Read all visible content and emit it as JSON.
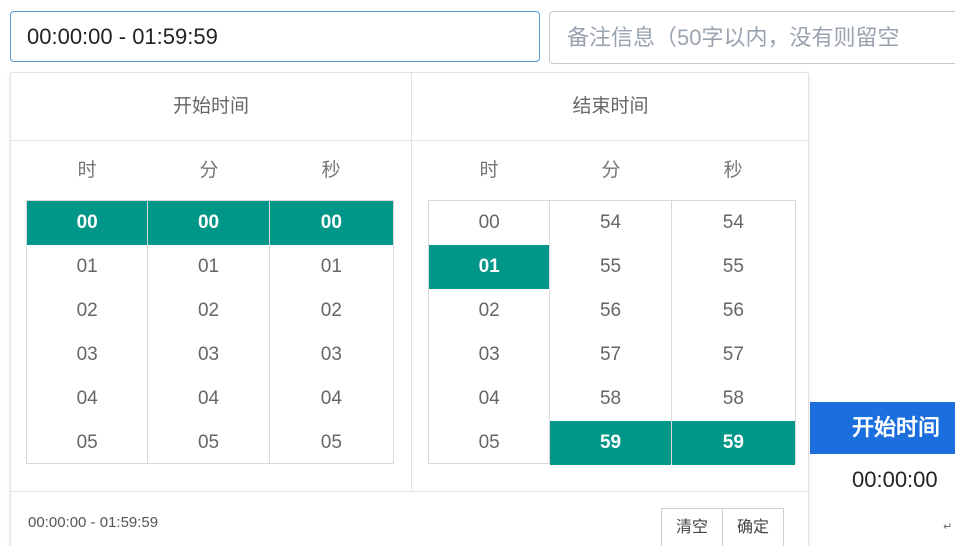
{
  "time_range_input": {
    "value": "00:00:00 - 01:59:59"
  },
  "remark_input": {
    "placeholder": "备注信息（50字以内，没有则留空"
  },
  "picker": {
    "start": {
      "title": "开始时间",
      "units": [
        "时",
        "分",
        "秒"
      ],
      "hours": [
        "00",
        "01",
        "02",
        "03",
        "04",
        "05"
      ],
      "minutes": [
        "00",
        "01",
        "02",
        "03",
        "04",
        "05"
      ],
      "seconds": [
        "00",
        "01",
        "02",
        "03",
        "04",
        "05"
      ],
      "selected": {
        "hour": "00",
        "minute": "00",
        "second": "00"
      }
    },
    "end": {
      "title": "结束时间",
      "units": [
        "时",
        "分",
        "秒"
      ],
      "hours": [
        "00",
        "01",
        "02",
        "03",
        "04",
        "05"
      ],
      "minutes": [
        "54",
        "55",
        "56",
        "57",
        "58",
        "59"
      ],
      "seconds": [
        "54",
        "55",
        "56",
        "57",
        "58",
        "59"
      ],
      "selected": {
        "hour": "01",
        "minute": "59",
        "second": "59"
      }
    },
    "footer": {
      "range": "00:00:00 - 01:59:59",
      "clear_label": "清空",
      "confirm_label": "确定"
    }
  },
  "table_fragment": {
    "header": "开始时间",
    "value": "00:00:00"
  },
  "colors": {
    "selected": "#009688",
    "header_bg": "#1b6ede",
    "input_border": "#5b9bd5"
  }
}
